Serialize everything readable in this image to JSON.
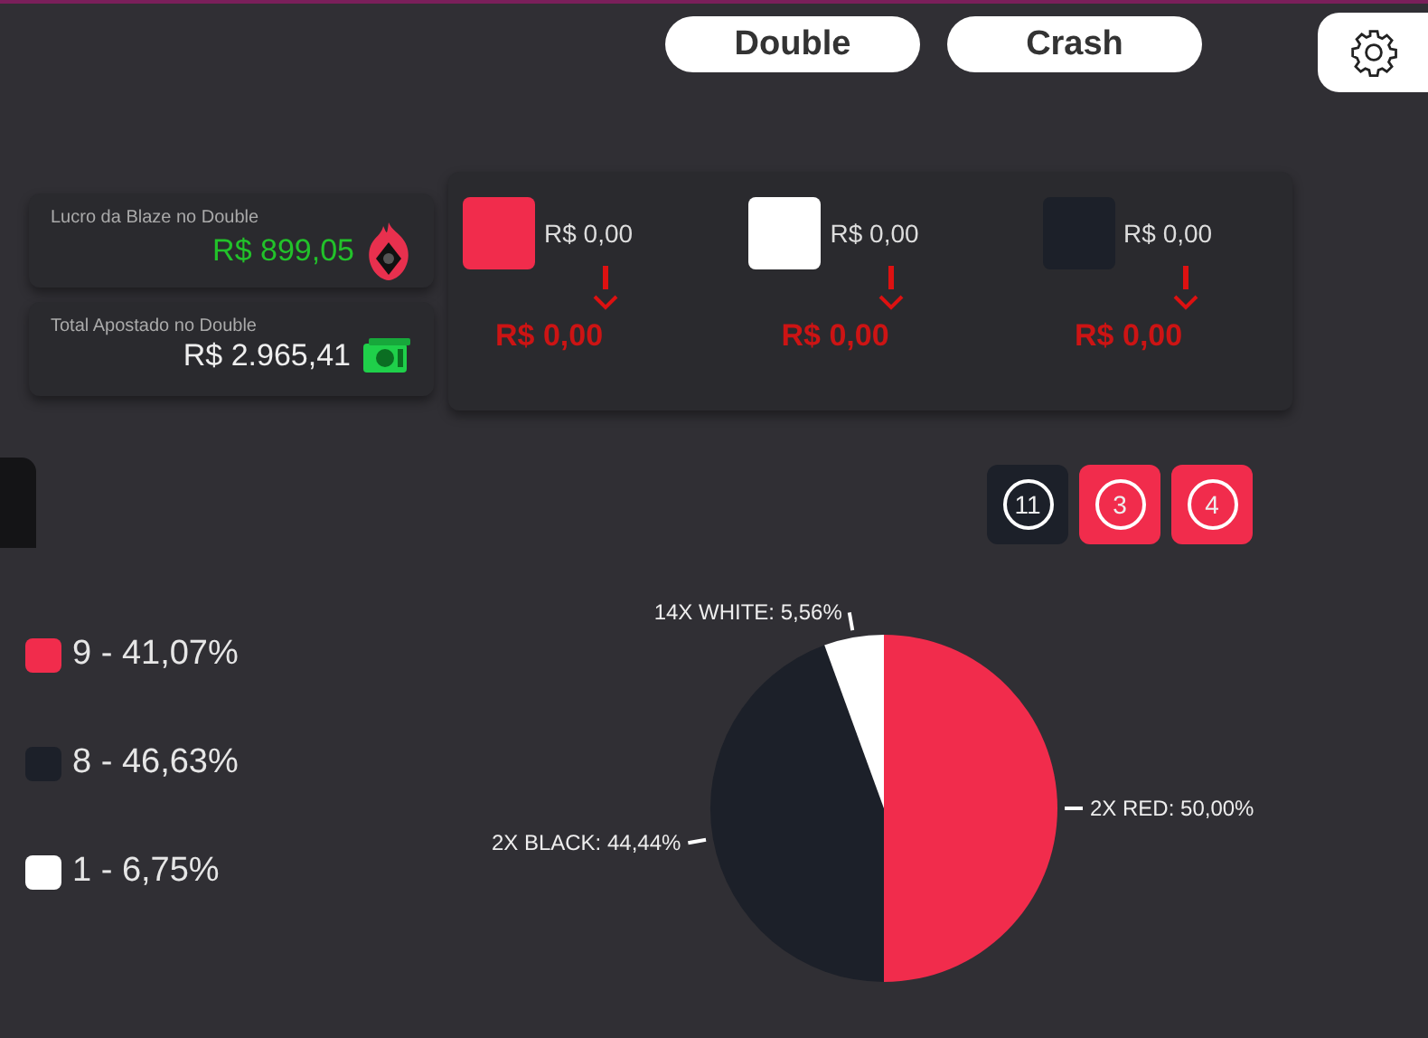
{
  "top_nav": {
    "tabs": [
      {
        "label": "Double"
      },
      {
        "label": "Crash"
      }
    ]
  },
  "stats": [
    {
      "label": "Lucro da Blaze no Double",
      "value": "R$ 899,05",
      "kind": "profit"
    },
    {
      "label": "Total Apostado no Double",
      "value": "R$ 2.965,41",
      "kind": "money"
    }
  ],
  "bets": [
    {
      "color": "#f12c4c",
      "amount": "R$ 0,00",
      "result": "R$ 0,00"
    },
    {
      "color": "#ffffff",
      "amount": "R$ 0,00",
      "result": "R$ 0,00"
    },
    {
      "color": "#1c2029",
      "amount": "R$ 0,00",
      "result": "R$ 0,00"
    }
  ],
  "counters": [
    {
      "count": "11",
      "color": "#1c2029"
    },
    {
      "count": "3",
      "color": "#f12c4c"
    },
    {
      "count": "4",
      "color": "#f12c4c"
    }
  ],
  "legend": [
    {
      "color": "#f12c4c",
      "text": "9 - 41,07%"
    },
    {
      "color": "#1c2029",
      "text": "8 - 46,63%"
    },
    {
      "color": "#ffffff",
      "text": "1 - 6,75%"
    }
  ],
  "pie": {
    "chart_data": {
      "type": "pie",
      "categories": [
        "2X RED",
        "2X BLACK",
        "14X WHITE"
      ],
      "values": [
        50,
        44.44,
        5.56
      ],
      "colors": [
        "#f12c4c",
        "#1c2029",
        "#ffffff"
      ],
      "data_labels": true,
      "value_labels": [
        "50,00%",
        "44,44%",
        "5,56%"
      ]
    }
  }
}
